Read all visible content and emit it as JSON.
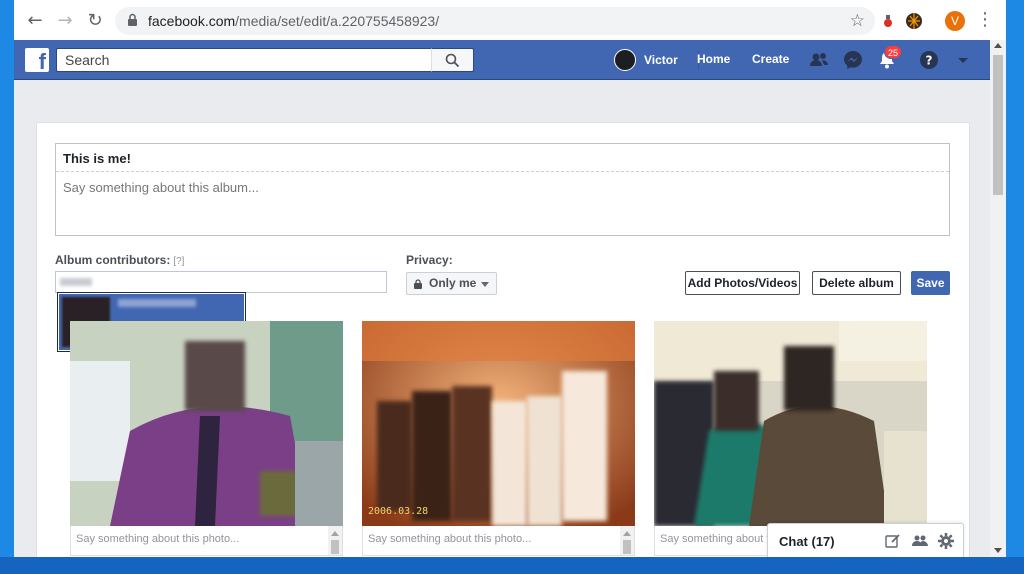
{
  "browser": {
    "url_host": "facebook.com",
    "url_path": "/media/set/edit/a.220755458923/",
    "profile_initial": "V"
  },
  "header": {
    "search_placeholder": "Search",
    "user_name": "Victor",
    "home_label": "Home",
    "create_label": "Create",
    "notification_count": "25"
  },
  "album": {
    "title": "This is me!",
    "description_placeholder": "Say something about this album...",
    "contributors_label": "Album contributors:",
    "contributors_hint": "[?]",
    "privacy_label": "Privacy:",
    "privacy_value": "Only me",
    "add_button": "Add Photos/Videos",
    "delete_button": "Delete album",
    "save_button": "Save"
  },
  "photos": [
    {
      "caption_placeholder": "Say something about this photo..."
    },
    {
      "caption_placeholder": "Say something about this photo...",
      "date_stamp": "2006.03.28"
    },
    {
      "caption_placeholder": "Say something about this photo..."
    }
  ],
  "chat": {
    "label": "Chat (17)"
  },
  "colors": {
    "fb_blue": "#4267b2",
    "page_bg": "#e9ebee",
    "badge_red": "#fa3e3e"
  }
}
